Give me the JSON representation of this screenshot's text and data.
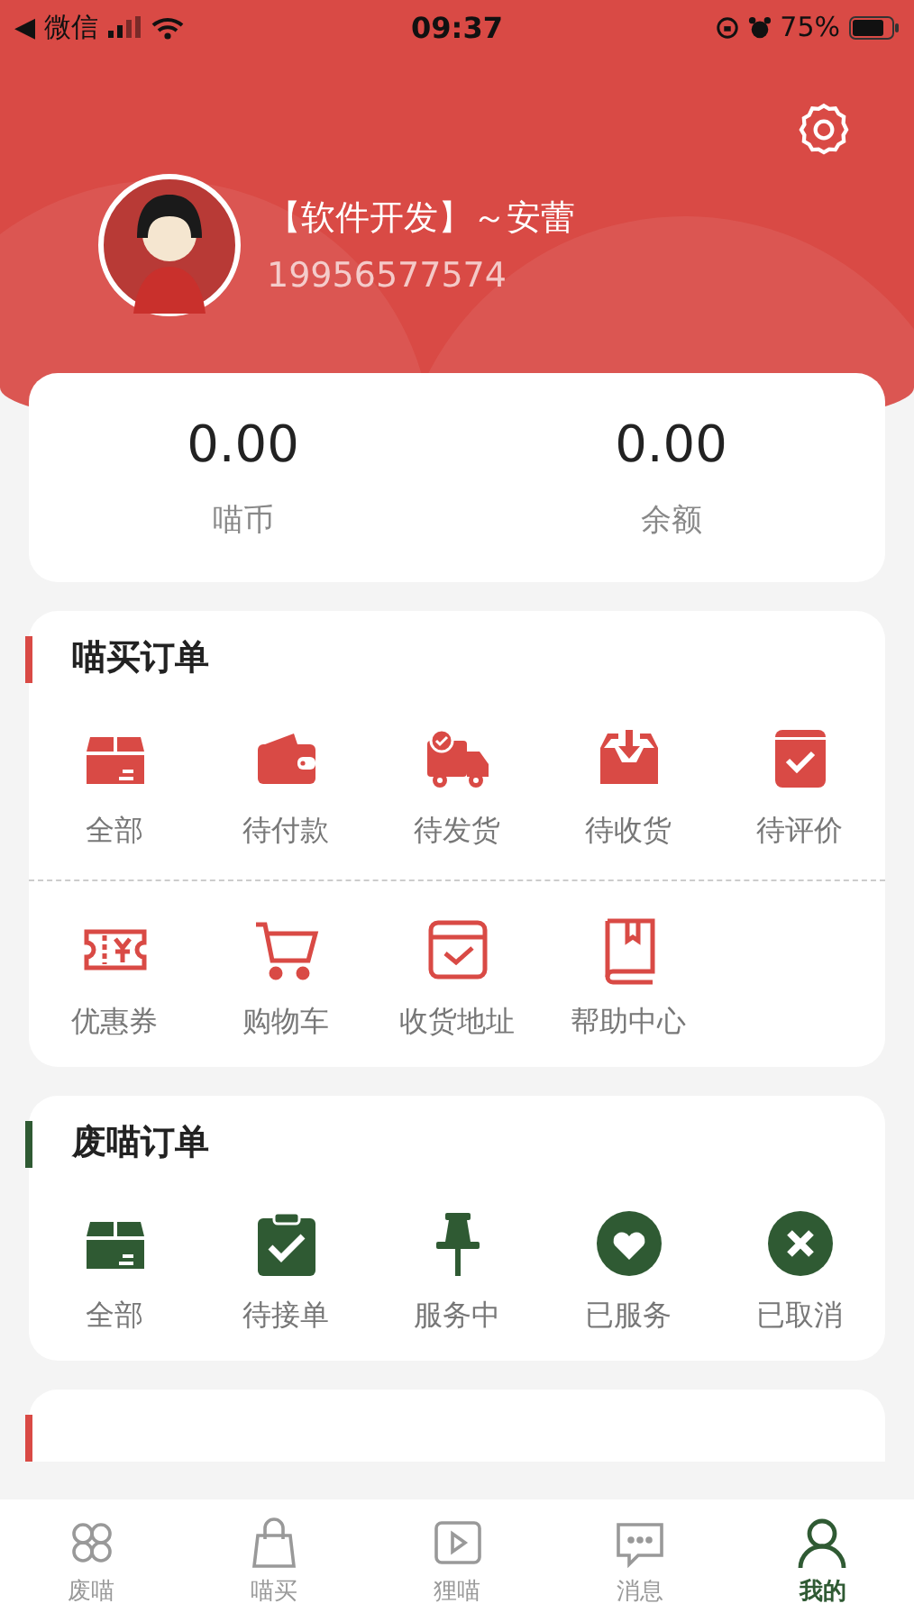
{
  "status_bar": {
    "back_app": "◀ 微信",
    "time": "09:37",
    "battery": "75%"
  },
  "profile": {
    "name": "【软件开发】～安蕾",
    "phone": "19956577574"
  },
  "stats": [
    {
      "value": "0.00",
      "label": "喵币"
    },
    {
      "value": "0.00",
      "label": "余额"
    }
  ],
  "shop_orders": {
    "title": "喵买订单",
    "items": [
      {
        "label": "全部"
      },
      {
        "label": "待付款"
      },
      {
        "label": "待发货"
      },
      {
        "label": "待收货"
      },
      {
        "label": "待评价"
      }
    ],
    "tools": [
      {
        "label": "优惠券"
      },
      {
        "label": "购物车"
      },
      {
        "label": "收货地址"
      },
      {
        "label": "帮助中心"
      }
    ]
  },
  "service_orders": {
    "title": "废喵订单",
    "items": [
      {
        "label": "全部"
      },
      {
        "label": "待接单"
      },
      {
        "label": "服务中"
      },
      {
        "label": "已服务"
      },
      {
        "label": "已取消"
      }
    ]
  },
  "tab_bar": [
    {
      "label": "废喵",
      "selected": false
    },
    {
      "label": "喵买",
      "selected": false
    },
    {
      "label": "狸喵",
      "selected": false
    },
    {
      "label": "消息",
      "selected": false
    },
    {
      "label": "我的",
      "selected": true
    }
  ]
}
